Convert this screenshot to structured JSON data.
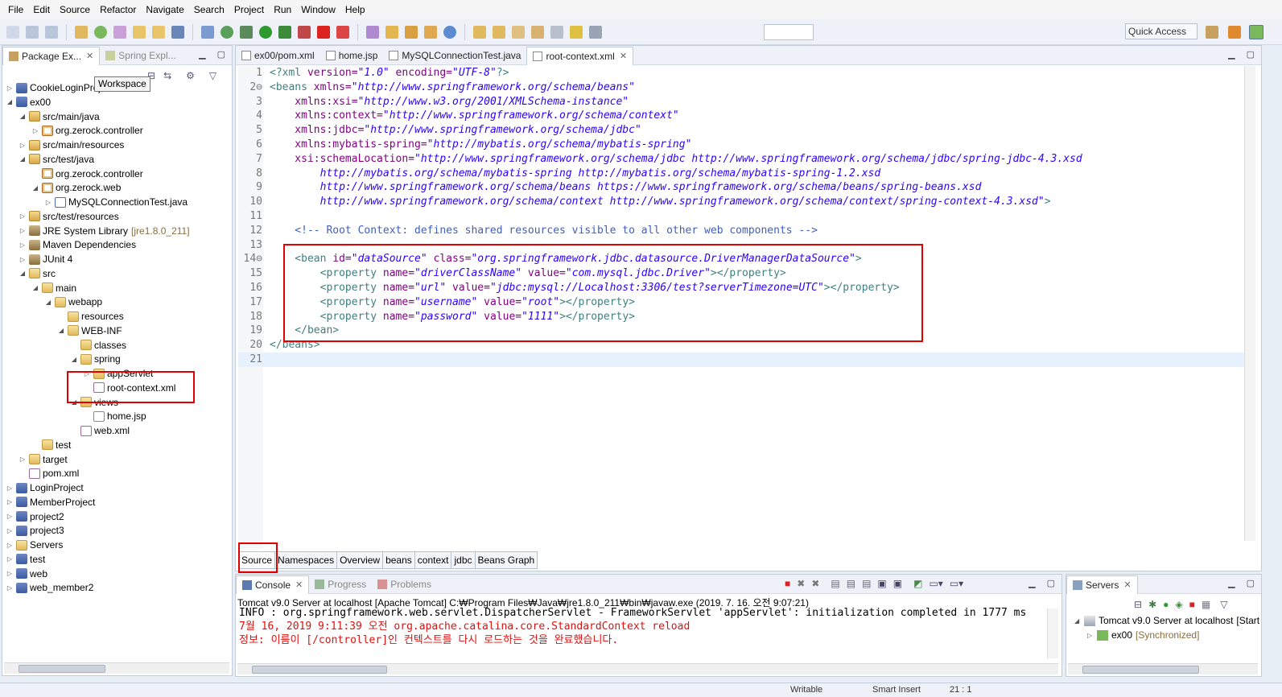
{
  "menu": [
    "File",
    "Edit",
    "Source",
    "Refactor",
    "Navigate",
    "Search",
    "Project",
    "Run",
    "Window",
    "Help"
  ],
  "quick_access": "Quick Access",
  "explorer": {
    "tabs": [
      "Package Ex...",
      "Spring Expl..."
    ],
    "tooltip": "Workspace",
    "tree": [
      {
        "label": "CookieLoginProject",
        "indent": 0,
        "icon": "proj",
        "twisty": "▷"
      },
      {
        "label": "ex00",
        "indent": 0,
        "icon": "proj",
        "twisty": "◢"
      },
      {
        "label": "src/main/java",
        "indent": 1,
        "icon": "pkgfolder",
        "twisty": "◢"
      },
      {
        "label": "org.zerock.controller",
        "indent": 2,
        "icon": "pkg",
        "twisty": "▷"
      },
      {
        "label": "src/main/resources",
        "indent": 1,
        "icon": "pkgfolder",
        "twisty": "▷"
      },
      {
        "label": "src/test/java",
        "indent": 1,
        "icon": "pkgfolder",
        "twisty": "◢"
      },
      {
        "label": "org.zerock.controller",
        "indent": 2,
        "icon": "pkg",
        "twisty": ""
      },
      {
        "label": "org.zerock.web",
        "indent": 2,
        "icon": "pkg",
        "twisty": "◢"
      },
      {
        "label": "MySQLConnectionTest.java",
        "indent": 3,
        "icon": "java",
        "twisty": "▷"
      },
      {
        "label": "src/test/resources",
        "indent": 1,
        "icon": "pkgfolder",
        "twisty": "▷"
      },
      {
        "label": "JRE System Library",
        "indent": 1,
        "icon": "lib",
        "twisty": "▷",
        "decoration": "[jre1.8.0_211]"
      },
      {
        "label": "Maven Dependencies",
        "indent": 1,
        "icon": "lib",
        "twisty": "▷"
      },
      {
        "label": "JUnit 4",
        "indent": 1,
        "icon": "lib",
        "twisty": "▷"
      },
      {
        "label": "src",
        "indent": 1,
        "icon": "folder",
        "twisty": "◢"
      },
      {
        "label": "main",
        "indent": 2,
        "icon": "folder",
        "twisty": "◢"
      },
      {
        "label": "webapp",
        "indent": 3,
        "icon": "folder",
        "twisty": "◢"
      },
      {
        "label": "resources",
        "indent": 4,
        "icon": "folder",
        "twisty": ""
      },
      {
        "label": "WEB-INF",
        "indent": 4,
        "icon": "folder",
        "twisty": "◢"
      },
      {
        "label": "classes",
        "indent": 5,
        "icon": "folder",
        "twisty": ""
      },
      {
        "label": "spring",
        "indent": 5,
        "icon": "folder",
        "twisty": "◢"
      },
      {
        "label": "appServlet",
        "indent": 6,
        "icon": "folder",
        "twisty": "▷"
      },
      {
        "label": "root-context.xml",
        "indent": 6,
        "icon": "xml",
        "twisty": ""
      },
      {
        "label": "views",
        "indent": 5,
        "icon": "folder",
        "twisty": "◢"
      },
      {
        "label": "home.jsp",
        "indent": 6,
        "icon": "file",
        "twisty": ""
      },
      {
        "label": "web.xml",
        "indent": 5,
        "icon": "xml",
        "twisty": ""
      },
      {
        "label": "test",
        "indent": 2,
        "icon": "folder",
        "twisty": ""
      },
      {
        "label": "target",
        "indent": 1,
        "icon": "folder",
        "twisty": "▷"
      },
      {
        "label": "pom.xml",
        "indent": 1,
        "icon": "xml",
        "twisty": ""
      },
      {
        "label": "LoginProject",
        "indent": 0,
        "icon": "proj",
        "twisty": "▷"
      },
      {
        "label": "MemberProject",
        "indent": 0,
        "icon": "proj",
        "twisty": "▷"
      },
      {
        "label": "project2",
        "indent": 0,
        "icon": "proj",
        "twisty": "▷"
      },
      {
        "label": "project3",
        "indent": 0,
        "icon": "proj",
        "twisty": "▷"
      },
      {
        "label": "Servers",
        "indent": 0,
        "icon": "folder",
        "twisty": "▷"
      },
      {
        "label": "test",
        "indent": 0,
        "icon": "proj",
        "twisty": "▷"
      },
      {
        "label": "web",
        "indent": 0,
        "icon": "proj",
        "twisty": "▷"
      },
      {
        "label": "web_member2",
        "indent": 0,
        "icon": "proj",
        "twisty": "▷"
      }
    ]
  },
  "editor": {
    "tabs": [
      {
        "label": "ex00/pom.xml",
        "active": false
      },
      {
        "label": "home.jsp",
        "active": false
      },
      {
        "label": "MySQLConnectionTest.java",
        "active": false
      },
      {
        "label": "root-context.xml",
        "active": true
      }
    ],
    "lines": [
      {
        "n": "1",
        "parts": [
          [
            "pi",
            "<?xml "
          ],
          [
            "attr",
            "version="
          ],
          [
            "val",
            "\"1.0\""
          ],
          [
            "attr",
            " encoding="
          ],
          [
            "val",
            "\"UTF-8\""
          ],
          [
            "pi",
            "?>"
          ]
        ]
      },
      {
        "n": "2⊖",
        "parts": [
          [
            "tag",
            "<beans "
          ],
          [
            "attr",
            "xmlns="
          ],
          [
            "val",
            "\"http://www.springframework.org/schema/beans\""
          ]
        ]
      },
      {
        "n": "3",
        "parts": [
          [
            "attr",
            "    xmlns:xsi="
          ],
          [
            "val",
            "\"http://www.w3.org/2001/XMLSchema-instance\""
          ]
        ]
      },
      {
        "n": "4",
        "parts": [
          [
            "attr",
            "    xmlns:context="
          ],
          [
            "val",
            "\"http://www.springframework.org/schema/context\""
          ]
        ]
      },
      {
        "n": "5",
        "parts": [
          [
            "attr",
            "    xmlns:jdbc="
          ],
          [
            "val",
            "\"http://www.springframework.org/schema/jdbc\""
          ]
        ]
      },
      {
        "n": "6",
        "parts": [
          [
            "attr",
            "    xmlns:mybatis-spring="
          ],
          [
            "val",
            "\"http://mybatis.org/schema/mybatis-spring\""
          ]
        ]
      },
      {
        "n": "7",
        "parts": [
          [
            "attr",
            "    xsi:schemaLocation="
          ],
          [
            "val",
            "\"http://www.springframework.org/schema/jdbc http://www.springframework.org/schema/jdbc/spring-jdbc-4.3.xsd"
          ]
        ]
      },
      {
        "n": "8",
        "parts": [
          [
            "val",
            "        http://mybatis.org/schema/mybatis-spring http://mybatis.org/schema/mybatis-spring-1.2.xsd"
          ]
        ]
      },
      {
        "n": "9",
        "parts": [
          [
            "val",
            "        http://www.springframework.org/schema/beans https://www.springframework.org/schema/beans/spring-beans.xsd"
          ]
        ]
      },
      {
        "n": "10",
        "parts": [
          [
            "val",
            "        http://www.springframework.org/schema/context http://www.springframework.org/schema/context/spring-context-4.3.xsd\""
          ],
          [
            "tag",
            ">"
          ]
        ]
      },
      {
        "n": "11",
        "parts": []
      },
      {
        "n": "12",
        "parts": [
          [
            "com",
            "    <!-- Root Context: defines shared resources visible to all other web components -->"
          ]
        ]
      },
      {
        "n": "13",
        "parts": []
      },
      {
        "n": "14⊖",
        "parts": [
          [
            "tag",
            "    <bean "
          ],
          [
            "attr",
            "id="
          ],
          [
            "val",
            "\"dataSource\""
          ],
          [
            "attr",
            " class="
          ],
          [
            "val",
            "\"org.springframework.jdbc.datasource.DriverManagerDataSource\""
          ],
          [
            "tag",
            ">"
          ]
        ]
      },
      {
        "n": "15",
        "parts": [
          [
            "tag",
            "        <property "
          ],
          [
            "attr",
            "name="
          ],
          [
            "val",
            "\"driverClassName\""
          ],
          [
            "attr",
            " value="
          ],
          [
            "val",
            "\"com.mysql.jdbc.Driver\""
          ],
          [
            "tag",
            "></property>"
          ]
        ]
      },
      {
        "n": "16",
        "parts": [
          [
            "tag",
            "        <property "
          ],
          [
            "attr",
            "name="
          ],
          [
            "val",
            "\"url\""
          ],
          [
            "attr",
            " value="
          ],
          [
            "val",
            "\"jdbc:mysql://Localhost:3306/test?serverTimezone=UTC\""
          ],
          [
            "tag",
            "></property>"
          ]
        ]
      },
      {
        "n": "17",
        "parts": [
          [
            "tag",
            "        <property "
          ],
          [
            "attr",
            "name="
          ],
          [
            "val",
            "\"username\""
          ],
          [
            "attr",
            " value="
          ],
          [
            "val",
            "\"root\""
          ],
          [
            "tag",
            "></property>"
          ]
        ]
      },
      {
        "n": "18",
        "parts": [
          [
            "tag",
            "        <property "
          ],
          [
            "attr",
            "name="
          ],
          [
            "val",
            "\"password\""
          ],
          [
            "attr",
            " value="
          ],
          [
            "val",
            "\"1111\""
          ],
          [
            "tag",
            "></property>"
          ]
        ]
      },
      {
        "n": "19",
        "parts": [
          [
            "tag",
            "    </bean>"
          ]
        ]
      },
      {
        "n": "20",
        "parts": [
          [
            "tag",
            "</beans>"
          ]
        ]
      },
      {
        "n": "21",
        "parts": []
      }
    ],
    "bottom_tabs": [
      "Source",
      "Namespaces",
      "Overview",
      "beans",
      "context",
      "jdbc",
      "Beans Graph"
    ]
  },
  "console": {
    "tabs": [
      "Console",
      "Progress",
      "Problems"
    ],
    "launch": "Tomcat v9.0 Server at localhost [Apache Tomcat] C:₩Program Files₩Java₩jre1.8.0_211₩bin₩javaw.exe (2019. 7. 16. 오전 9:07:21)",
    "lines": [
      "INFO : org.springframework.web.servlet.DispatcherServlet - FrameworkServlet 'appServlet': initialization completed in 1777 ms",
      "7월 16, 2019 9:11:39 오전 org.apache.catalina.core.StandardContext reload",
      "정보: 이름이 [/controller]인 컨텍스트를 다시 로드하는 것을 완료했습니다."
    ]
  },
  "servers": {
    "tab": "Servers",
    "server": "Tomcat v9.0 Server at localhost",
    "server_state": "[Start",
    "module": "ex00",
    "module_state": "[Synchronized]"
  },
  "status": {
    "writable": "Writable",
    "insert": "Smart Insert",
    "pos": "21 : 1"
  }
}
